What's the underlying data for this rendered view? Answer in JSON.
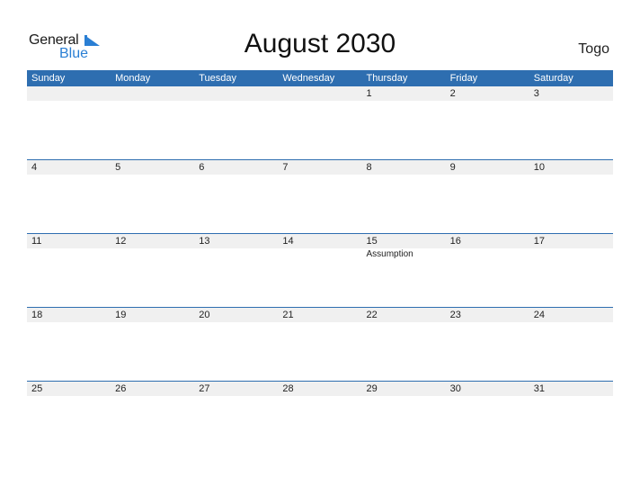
{
  "logo": {
    "word1": "General",
    "word2": "Blue"
  },
  "title": "August 2030",
  "country": "Togo",
  "colors": {
    "header_bg": "#2e6eb0",
    "strip_bg": "#f0f0f0",
    "logo_blue": "#2a7fd4"
  },
  "weekdays": [
    "Sunday",
    "Monday",
    "Tuesday",
    "Wednesday",
    "Thursday",
    "Friday",
    "Saturday"
  ],
  "weeks": [
    [
      {
        "d": ""
      },
      {
        "d": ""
      },
      {
        "d": ""
      },
      {
        "d": ""
      },
      {
        "d": "1"
      },
      {
        "d": "2"
      },
      {
        "d": "3"
      }
    ],
    [
      {
        "d": "4"
      },
      {
        "d": "5"
      },
      {
        "d": "6"
      },
      {
        "d": "7"
      },
      {
        "d": "8"
      },
      {
        "d": "9"
      },
      {
        "d": "10"
      }
    ],
    [
      {
        "d": "11"
      },
      {
        "d": "12"
      },
      {
        "d": "13"
      },
      {
        "d": "14"
      },
      {
        "d": "15",
        "event": "Assumption"
      },
      {
        "d": "16"
      },
      {
        "d": "17"
      }
    ],
    [
      {
        "d": "18"
      },
      {
        "d": "19"
      },
      {
        "d": "20"
      },
      {
        "d": "21"
      },
      {
        "d": "22"
      },
      {
        "d": "23"
      },
      {
        "d": "24"
      }
    ],
    [
      {
        "d": "25"
      },
      {
        "d": "26"
      },
      {
        "d": "27"
      },
      {
        "d": "28"
      },
      {
        "d": "29"
      },
      {
        "d": "30"
      },
      {
        "d": "31"
      }
    ]
  ]
}
